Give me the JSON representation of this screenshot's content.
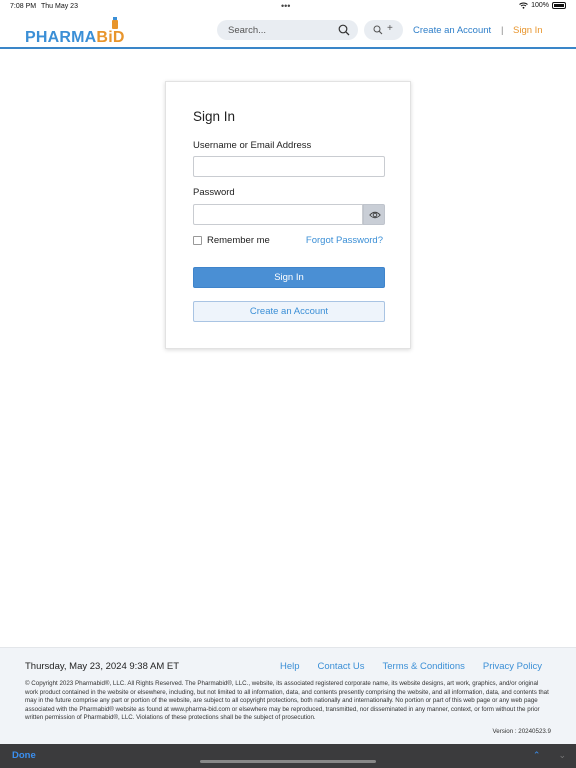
{
  "status_bar": {
    "time": "7:08 PM",
    "date": "Thu May 23",
    "battery": "100%",
    "dots": "•••"
  },
  "header": {
    "logo": {
      "part1": "PHARMA",
      "part2": "B",
      "part3": "iD"
    },
    "search_placeholder": "Search...",
    "advanced_plus": "+",
    "create_account": "Create an Account",
    "separator": "|",
    "sign_in": "Sign In"
  },
  "signin": {
    "title": "Sign In",
    "username_label": "Username or Email Address",
    "username_value": "",
    "password_label": "Password",
    "password_value": "",
    "remember_label": "Remember me",
    "forgot_label": "Forgot Password?",
    "signin_button": "Sign In",
    "create_button": "Create an Account"
  },
  "footer": {
    "date": "Thursday, May 23, 2024 9:38 AM ET",
    "links": [
      "Help",
      "Contact Us",
      "Terms & Conditions",
      "Privacy Policy"
    ],
    "copyright": "© Copyright 2023 Pharmabid®, LLC. All Rights Reserved. The Pharmabid®, LLC., website, its associated registered corporate name, its website designs, art work, graphics, and/or original work product contained in the website or elsewhere, including, but not limited to all information, data, and contents presently comprising the website, and all information, data, and contents that may in the future comprise any part or portion of the website, are subject to all copyright protections, both nationally and internationally. No portion or part of this web page or any web page associated with the Pharmabid® website as found at www.pharma-bid.com or elsewhere may be reproduced, transmitted, nor disseminated in any manner, context, or form without the prior written permission of Pharmabid®, LLC. Violations of these protections shall be the subject of prosecution.",
    "version": "Version : 20240523.9"
  },
  "bottom_bar": {
    "done": "Done",
    "up_arrow": "⌃",
    "down_arrow": "⌄"
  },
  "colors": {
    "brand_blue": "#3b8fd6",
    "brand_orange": "#e8952c",
    "button_blue": "#4a8fd4"
  }
}
